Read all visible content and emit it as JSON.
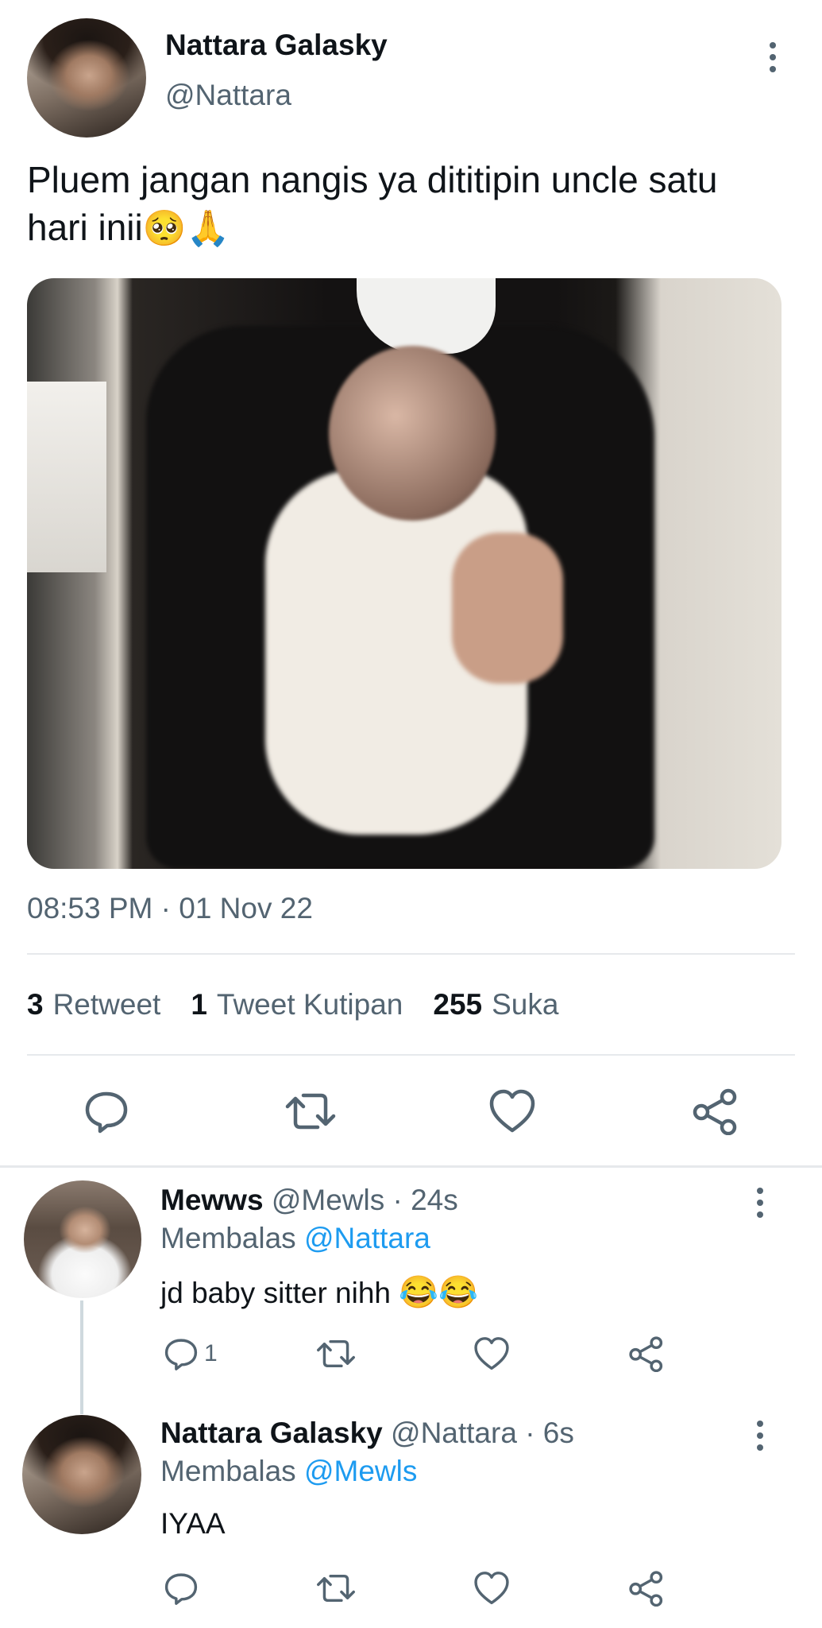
{
  "tweet": {
    "author_name": "Nattara Galasky",
    "author_handle": "@Nattara",
    "text": "Pluem jangan nangis ya dititipin uncle satu hari inii",
    "emojis": "🥺🙏",
    "timestamp": "08:53 PM · 01 Nov 22",
    "stats": {
      "retweets_count": "3",
      "retweets_label": "Retweet",
      "quotes_count": "1",
      "quotes_label": "Tweet Kutipan",
      "likes_count": "255",
      "likes_label": "Suka"
    }
  },
  "replies": [
    {
      "name": "Mewws",
      "meta": "@Mewls · 24s",
      "replying_label": "Membalas",
      "replying_to": "@Nattara",
      "text": "jd baby sitter nihh",
      "emojis": "😂😂",
      "reply_count": "1"
    },
    {
      "name": "Nattara Galasky",
      "meta": "@Nattara · 6s",
      "replying_label": "Membalas",
      "replying_to": "@Mewls",
      "text": "IYAA",
      "reply_count": ""
    }
  ],
  "icons": {
    "reply": "reply-icon",
    "retweet": "retweet-icon",
    "like": "like-icon",
    "share": "share-icon",
    "more": "more-icon"
  },
  "colors": {
    "text": "#0f1419",
    "secondary": "#536471",
    "accent": "#1d9bf0",
    "divider": "#e6e9ec"
  }
}
